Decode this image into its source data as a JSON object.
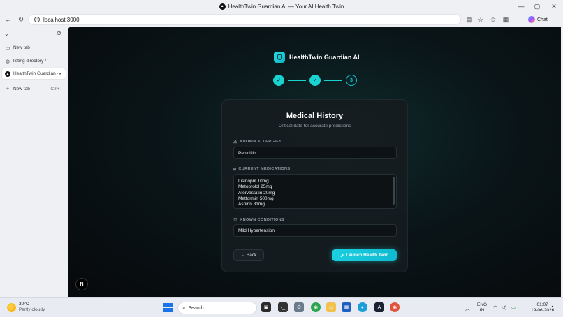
{
  "window": {
    "title": "HealthTwin Guardian AI — Your AI Health Twin",
    "controls": {
      "minimize": "—",
      "maximize": "▢",
      "close": "✕"
    }
  },
  "toolbar": {
    "url": "localhost:3000",
    "chat_label": "Chat"
  },
  "sidebar": {
    "items": [
      {
        "label": "New tab"
      },
      {
        "label": "listing directory /"
      },
      {
        "label": "HealthTwin Guardian ·"
      },
      {
        "label": "New tab",
        "shortcut": "Ctrl+T"
      }
    ]
  },
  "app": {
    "brand": "HealthTwin Guardian AI",
    "steps": [
      {
        "state": "done",
        "label": "✓"
      },
      {
        "state": "done",
        "label": "✓"
      },
      {
        "state": "current",
        "label": "3"
      }
    ],
    "card": {
      "title": "Medical History",
      "subtitle": "Critical data for accurate predictions",
      "allergies": {
        "label": "KNOWN ALLERGIES",
        "value": "Penicillin"
      },
      "medications": {
        "label": "CURRENT MEDICATIONS",
        "lines": [
          "Lisinopril 10mg",
          "Metoprolol 25mg",
          "Atorvastatin 20mg",
          "Metformin 500mg",
          "Aspirin 81mg"
        ]
      },
      "conditions": {
        "label": "KNOWN CONDITIONS",
        "value": "Mild Hypertension"
      },
      "back_label": "← Back",
      "launch_label": "Launch Health Twin"
    },
    "next_badge": "N"
  },
  "taskbar": {
    "weather_temp": "30°C",
    "weather_cond": "Partly cloudy",
    "search_label": "Search",
    "lang_top": "ENG",
    "lang_bottom": "IN",
    "time": "01:07",
    "date": "19-06-2026"
  },
  "colors": {
    "accent": "#19d3d0",
    "launch": "#1ad0e0",
    "bg": "#07090b"
  }
}
